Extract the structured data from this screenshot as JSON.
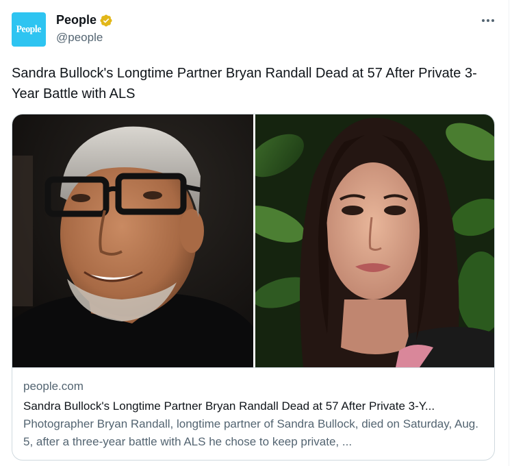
{
  "author": {
    "avatar_text": "People",
    "display_name": "People",
    "handle": "@people",
    "verified_color": "#e2b719"
  },
  "tweet": {
    "text": "Sandra Bullock's Longtime Partner Bryan Randall Dead at 57 After Private 3-Year Battle with ALS"
  },
  "card": {
    "domain": "people.com",
    "title": "Sandra Bullock's Longtime Partner Bryan Randall Dead at 57 After Private 3-Y...",
    "description": "Photographer Bryan Randall, longtime partner of Sandra Bullock, died on Saturday, Aug. 5, after a three-year battle with ALS he chose to keep private, ..."
  },
  "icons": {
    "verified": "verified-badge-icon",
    "more": "more-horizontal-icon"
  },
  "colors": {
    "avatar_bg": "#2ec4f1",
    "text_primary": "#0f1419",
    "text_secondary": "#536471",
    "border": "#cfd9de"
  }
}
